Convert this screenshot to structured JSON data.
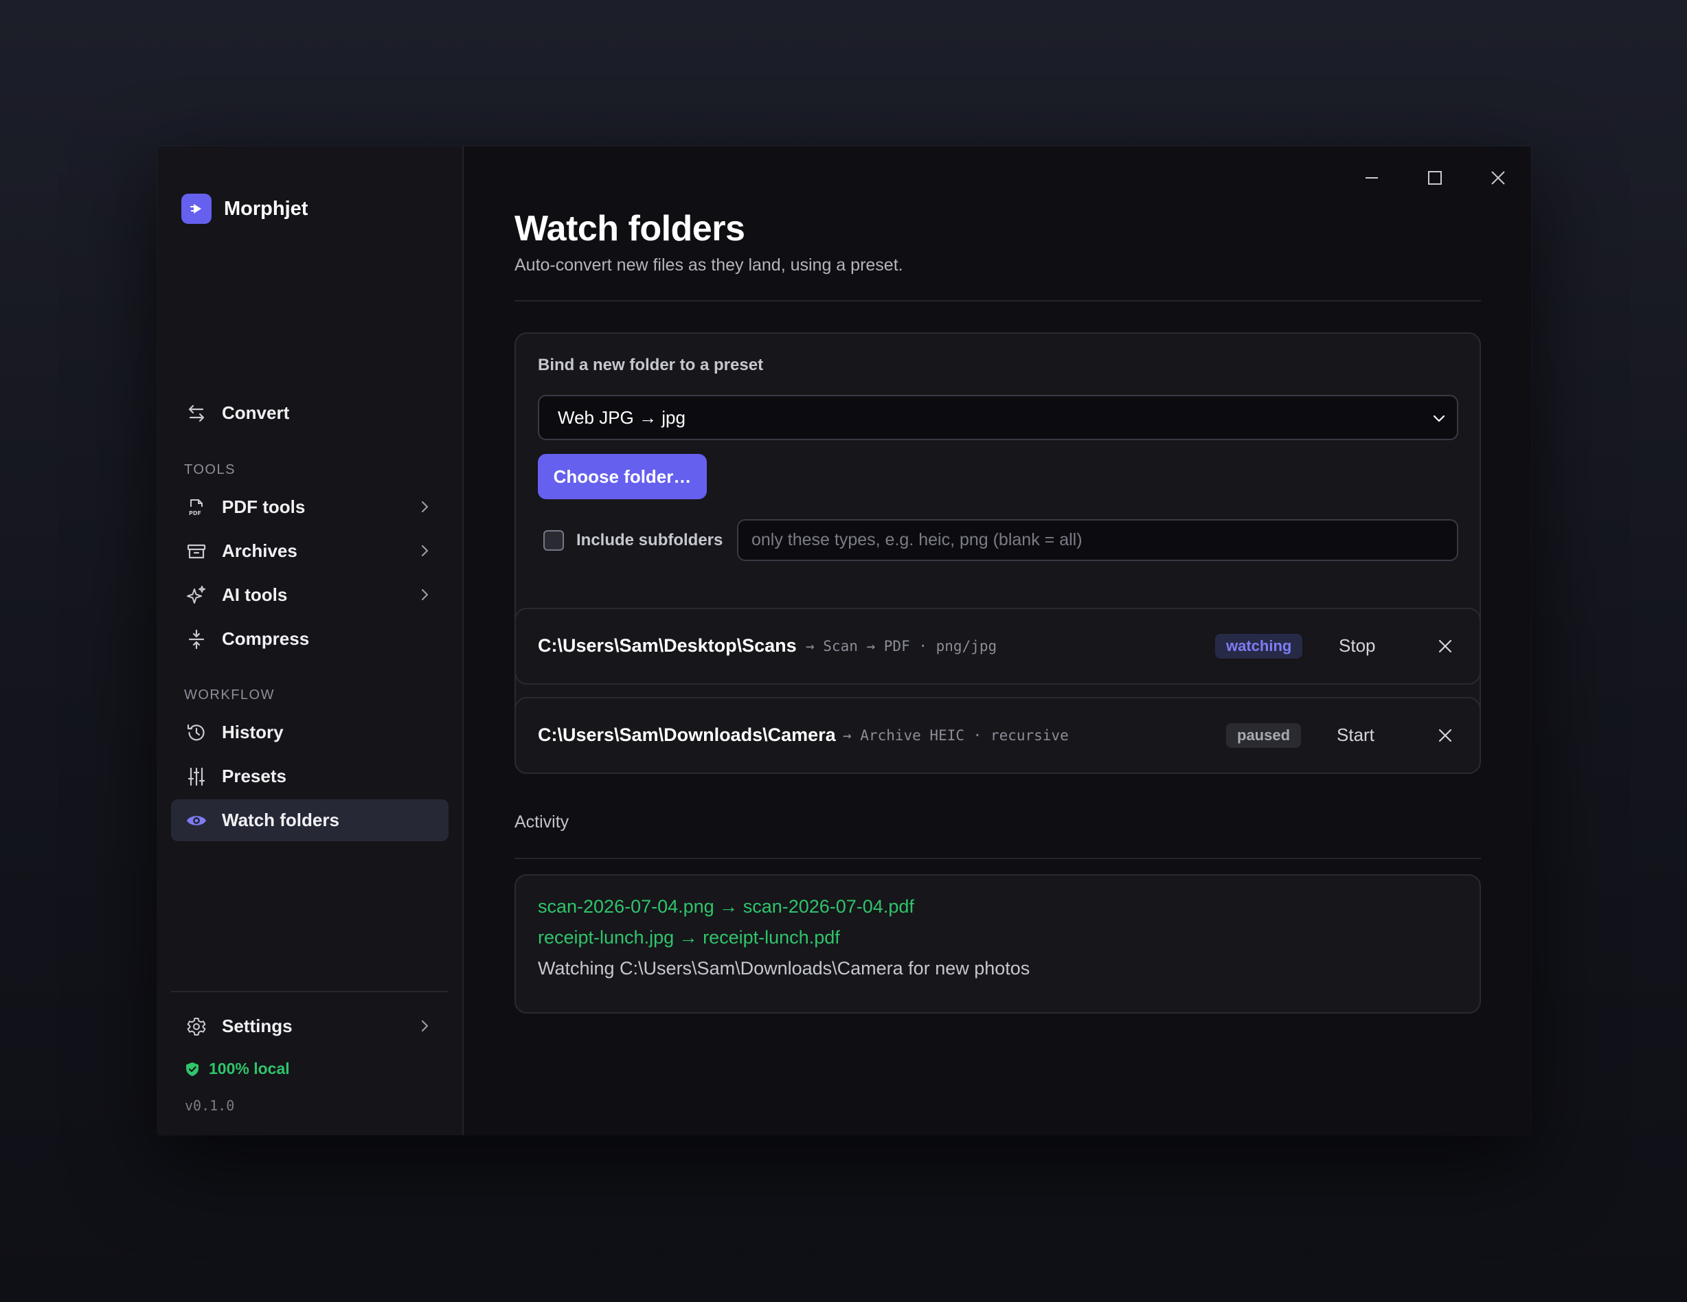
{
  "app": {
    "name": "Morphjet"
  },
  "colors": {
    "accent": "#6560ee",
    "success": "#2fc56a",
    "watching": "#7f7cf4"
  },
  "sidebar": {
    "convert": {
      "label": "Convert",
      "icon": "arrows-swap-icon"
    },
    "tools_label": "TOOLS",
    "tools": [
      {
        "label": "PDF tools",
        "icon": "pdf-file-icon",
        "has_submenu": true
      },
      {
        "label": "Archives",
        "icon": "archive-box-icon",
        "has_submenu": true
      },
      {
        "label": "AI tools",
        "icon": "sparkles-icon",
        "has_submenu": true
      },
      {
        "label": "Compress",
        "icon": "compress-icon",
        "has_submenu": false
      }
    ],
    "workflow_label": "WORKFLOW",
    "workflow": [
      {
        "label": "History",
        "icon": "history-icon"
      },
      {
        "label": "Presets",
        "icon": "sliders-icon"
      },
      {
        "label": "Watch folders",
        "icon": "eye-icon",
        "active": true
      }
    ],
    "settings": {
      "label": "Settings",
      "icon": "gear-icon"
    },
    "local_badge": "100% local",
    "version": "v0.1.0"
  },
  "page": {
    "title": "Watch folders",
    "subtitle": "Auto-convert new files as they land, using a preset."
  },
  "bind_card": {
    "title": "Bind a new folder to a preset",
    "preset_selected": "Web JPG → jpg",
    "choose_button": "Choose folder…",
    "include_subfolders_label": "Include subfolders",
    "include_subfolders_checked": false,
    "types_placeholder": "only these types, e.g. heic, png (blank = all)"
  },
  "watch_rows": [
    {
      "path": "C:\\Users\\Sam\\Desktop\\Scans",
      "meta": "→ Scan → PDF · png/jpg",
      "status": "watching",
      "action": "Stop"
    },
    {
      "path": "C:\\Users\\Sam\\Downloads\\Camera",
      "meta": "→ Archive HEIC · recursive",
      "status": "paused",
      "action": "Start"
    }
  ],
  "activity": {
    "label": "Activity",
    "lines": [
      {
        "text": "scan-2026-07-04.png → scan-2026-07-04.pdf",
        "kind": "success"
      },
      {
        "text": "receipt-lunch.jpg → receipt-lunch.pdf",
        "kind": "success"
      },
      {
        "text": "Watching C:\\Users\\Sam\\Downloads\\Camera for new photos",
        "kind": "info"
      }
    ]
  }
}
